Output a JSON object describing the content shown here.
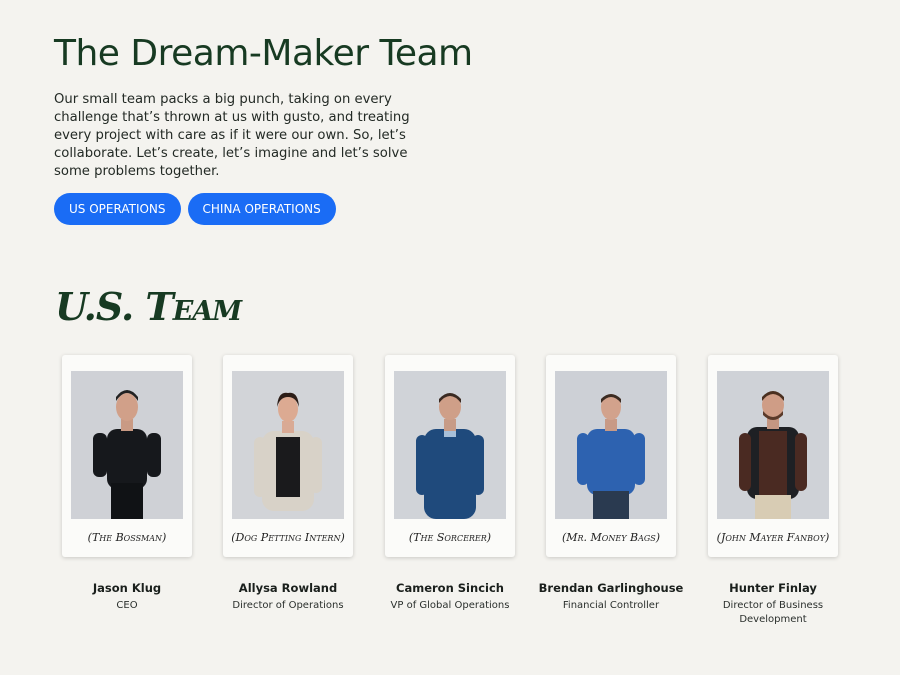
{
  "header": {
    "title": "The Dream-Maker Team",
    "intro": "Our small team packs a big punch, taking on every challenge that’s thrown at us with gusto, and treating every project with care as if it were our own. So, let’s collaborate. Let’s create, let’s imagine and let’s solve some problems together."
  },
  "buttons": {
    "us_operations": "US OPERATIONS",
    "china_operations": "CHINA OPERATIONS"
  },
  "colors": {
    "background": "#f4f3ef",
    "accent_button": "#1a6cf5",
    "heading_green": "#173a22"
  },
  "section": {
    "title": "U.S. Team"
  },
  "team": [
    {
      "nickname": "(The Bossman)",
      "name": "Jason Klug",
      "role": "CEO",
      "icon": "person-photo"
    },
    {
      "nickname": "(Dog Petting Intern)",
      "name": "Allysa Rowland",
      "role": "Director of Operations",
      "icon": "person-photo"
    },
    {
      "nickname": "(The Sorcerer)",
      "name": "Cameron Sincich",
      "role": "VP of Global Operations",
      "icon": "person-photo"
    },
    {
      "nickname": "(Mr. Money Bags)",
      "name": "Brendan Garlinghouse",
      "role": "Financial Controller",
      "icon": "person-photo"
    },
    {
      "nickname": "(John Mayer Fanboy)",
      "name": "Hunter Finlay",
      "role": "Director of Business Development",
      "icon": "person-photo"
    }
  ]
}
